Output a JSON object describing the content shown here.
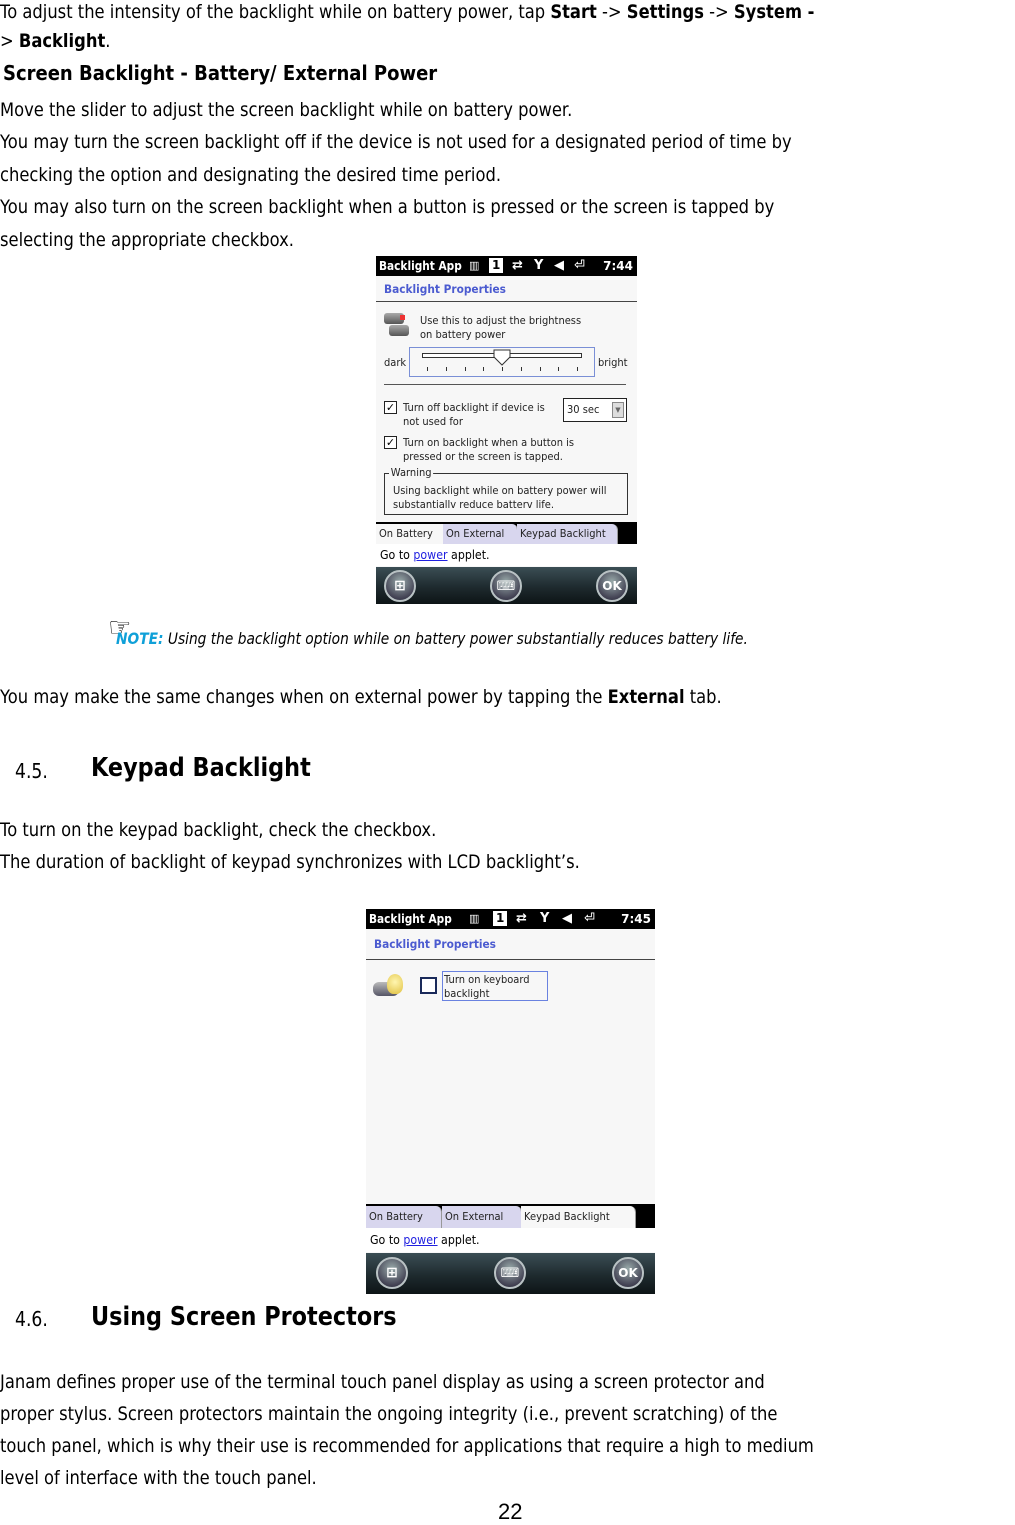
{
  "intro": {
    "line1_prefix": "To adjust the intensity of the backlight while on battery power, tap ",
    "path": [
      "Start",
      "Settings",
      "System",
      "Backlight"
    ],
    "arrow": " -> ",
    "line1_start": "Start",
    "line1_settings": "Settings",
    "line1_system": "System -",
    "line2_prefix": "> ",
    "line2_backlight": "Backlight",
    "line2_suffix": "."
  },
  "subheading": "Screen Backlight - Battery/ External Power",
  "paragraph1": [
    "Move the slider to adjust the screen backlight while on battery power.",
    "You may turn the screen backlight off if the device is not used for a designated period of time by",
    "checking the option and designating the desired time period.",
    "You may also turn on the screen backlight when a button is pressed or the screen is tapped by",
    "selecting the appropriate checkbox."
  ],
  "screen1": {
    "title_bar": {
      "app_name": "Backlight App",
      "indicator_1": "1",
      "time": "7:44"
    },
    "header": "Backlight Properties",
    "brightness_label_1": "Use this to adjust the brightness",
    "brightness_label_2": "on battery power",
    "slider": {
      "min_label": "dark",
      "max_label": "bright",
      "value_fraction": 0.5,
      "ticks": 9
    },
    "option_turn_off": {
      "checked": true,
      "label_1": "Turn off backlight if device is",
      "label_2": "not used for"
    },
    "timeout_select": {
      "value": "30 sec"
    },
    "option_turn_on": {
      "checked": true,
      "label_1": "Turn on backlight when a button is",
      "label_2": "pressed or the screen is tapped."
    },
    "warning": {
      "legend": "Warning",
      "text_1": "Using backlight while on battery power will",
      "text_2": "substantiallv reduce batterv life."
    },
    "tabs": [
      {
        "label": "On Battery",
        "active": true
      },
      {
        "label": "On External",
        "active": false
      },
      {
        "label": "Keypad Backlight",
        "active": false
      }
    ],
    "goto": {
      "prefix": "Go to ",
      "link": "power",
      "suffix": " applet."
    },
    "softkeys": {
      "start": "start",
      "keyboard": "keyboard",
      "ok": "OK"
    }
  },
  "note": {
    "label": "NOTE:",
    "text": " Using the backlight option while on battery power substantially reduces battery life."
  },
  "external_sentence": {
    "prefix": "You may make the same changes when on external power by tapping the ",
    "bold": "External",
    "suffix": " tab."
  },
  "section_45": {
    "number": "4.5.",
    "title": "Keypad Backlight",
    "lines": [
      "To turn on the keypad backlight, check the checkbox.",
      "The duration of backlight of keypad synchronizes with LCD backlight’s."
    ]
  },
  "screen2": {
    "title_bar": {
      "app_name": "Backlight App",
      "indicator_1": "1",
      "time": "7:45"
    },
    "header": "Backlight Properties",
    "keyboard_option": {
      "checked": false,
      "label_1": "Turn on keyboard",
      "label_2": "backlight"
    },
    "tabs": [
      {
        "label": "On Battery",
        "active": false
      },
      {
        "label": "On External",
        "active": false
      },
      {
        "label": "Keypad Backlight",
        "active": true
      }
    ],
    "goto": {
      "prefix": "Go to ",
      "link": "power",
      "suffix": " applet."
    },
    "softkeys": {
      "start": "start",
      "keyboard": "keyboard",
      "ok": "OK"
    }
  },
  "section_46": {
    "number": "4.6.",
    "title": "Using Screen Protectors",
    "lines": [
      "Janam defines proper use of the terminal touch panel display as using a screen protector and",
      "proper stylus. Screen protectors maintain the ongoing integrity (i.e., prevent scratching) of the",
      "touch panel, which is why their use is recommended for applications that require a high to medium",
      "level of interface with the touch panel."
    ]
  },
  "page_number": "22",
  "colors": {
    "note_accent": "#0fa0d8",
    "device_header": "#4b5bd0",
    "link": "#2020e0"
  }
}
